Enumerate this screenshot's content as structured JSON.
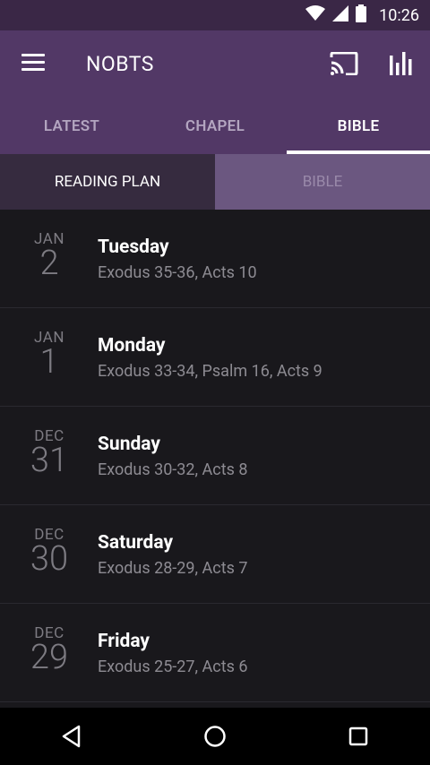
{
  "status": {
    "time": "10:26"
  },
  "appbar": {
    "title": "NOBTS"
  },
  "tabs": [
    {
      "label": "LATEST"
    },
    {
      "label": "CHAPEL"
    },
    {
      "label": "BIBLE"
    }
  ],
  "segments": {
    "left": "READING PLAN",
    "right": "BIBLE"
  },
  "readings": [
    {
      "month": "JAN",
      "day": "2",
      "weekday": "Tuesday",
      "passage": "Exodus 35-36, Acts 10"
    },
    {
      "month": "JAN",
      "day": "1",
      "weekday": "Monday",
      "passage": "Exodus 33-34, Psalm 16, Acts 9"
    },
    {
      "month": "DEC",
      "day": "31",
      "weekday": "Sunday",
      "passage": "Exodus 30-32, Acts 8"
    },
    {
      "month": "DEC",
      "day": "30",
      "weekday": "Saturday",
      "passage": "Exodus 28-29, Acts 7"
    },
    {
      "month": "DEC",
      "day": "29",
      "weekday": "Friday",
      "passage": "Exodus 25-27, Acts 6"
    }
  ],
  "icons": {
    "menu": "hamburger-menu-icon",
    "cast": "cast-icon",
    "stats": "bar-chart-icon",
    "back": "back-triangle-icon",
    "home": "home-circle-icon",
    "recents": "recents-square-icon"
  },
  "colors": {
    "appbar": "#523866",
    "statusbar": "#3a2746",
    "background": "#19181c"
  }
}
